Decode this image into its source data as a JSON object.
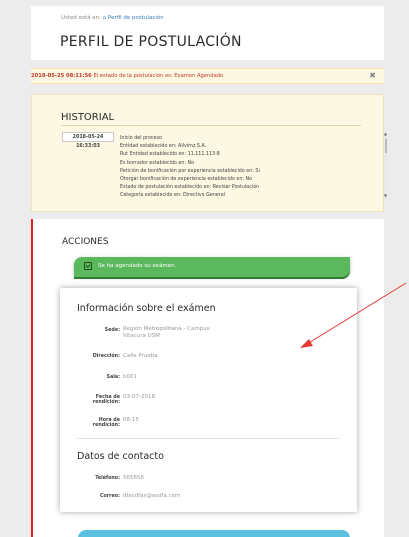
{
  "header": {
    "breadcrumb_prefix": "Usted está en:",
    "breadcrumb_link": "Perfil de postulación",
    "title": "PERFIL DE POSTULACIÓN"
  },
  "alert": {
    "timestamp": "2018-05-25 08:11:56",
    "message": "El estado de la postulación es: Examen Agendado",
    "close": "✖"
  },
  "historial": {
    "title": "HISTORIAL",
    "date": "2018-05-24 16:33:03",
    "lines": [
      "Inicio del proceso",
      "Entidad establecido en: Allvimz S.A.",
      "Rut Entidad establecido en: 11.111.113-8",
      "Es borrador establecido en: No",
      "Petición de bonificación por experiencia establecido en: Si",
      "Otorgar bonificación de experiencia establecido en: No",
      "Estado de postulación establecido en: Revisar Postulación",
      "Categoría establecido en: Directivo General"
    ]
  },
  "acciones": {
    "title": "ACCIONES",
    "badge": "Se ha agendado su exámen.",
    "exam_info": {
      "title": "Información sobre el exámen",
      "fields": [
        {
          "label": "Sede:",
          "value_lines": [
            "Región Metropolitana - Campus",
            "Vitacura USM"
          ]
        },
        {
          "label": "Dirección:",
          "value_lines": [
            "Calle Prueba"
          ]
        },
        {
          "label": "Sala:",
          "value_lines": [
            "b001"
          ]
        },
        {
          "label_lines": [
            "Fecha de",
            "rendición:"
          ],
          "value_lines": [
            "03-07-2018"
          ]
        },
        {
          "label_lines": [
            "Hora de",
            "rendición:"
          ],
          "value_lines": [
            "08:15"
          ]
        }
      ]
    },
    "contact": {
      "title": "Datos de contacto",
      "phone_label": "Teléfono:",
      "phone": "565656",
      "email_label": "Correo:",
      "email": "dfasdfas@asdfa.com"
    }
  },
  "colors": {
    "accent_red": "#d9211f",
    "success_green": "#5cb85c",
    "info_blue": "#5bc0de",
    "warning_bg": "#fcf8e3"
  }
}
